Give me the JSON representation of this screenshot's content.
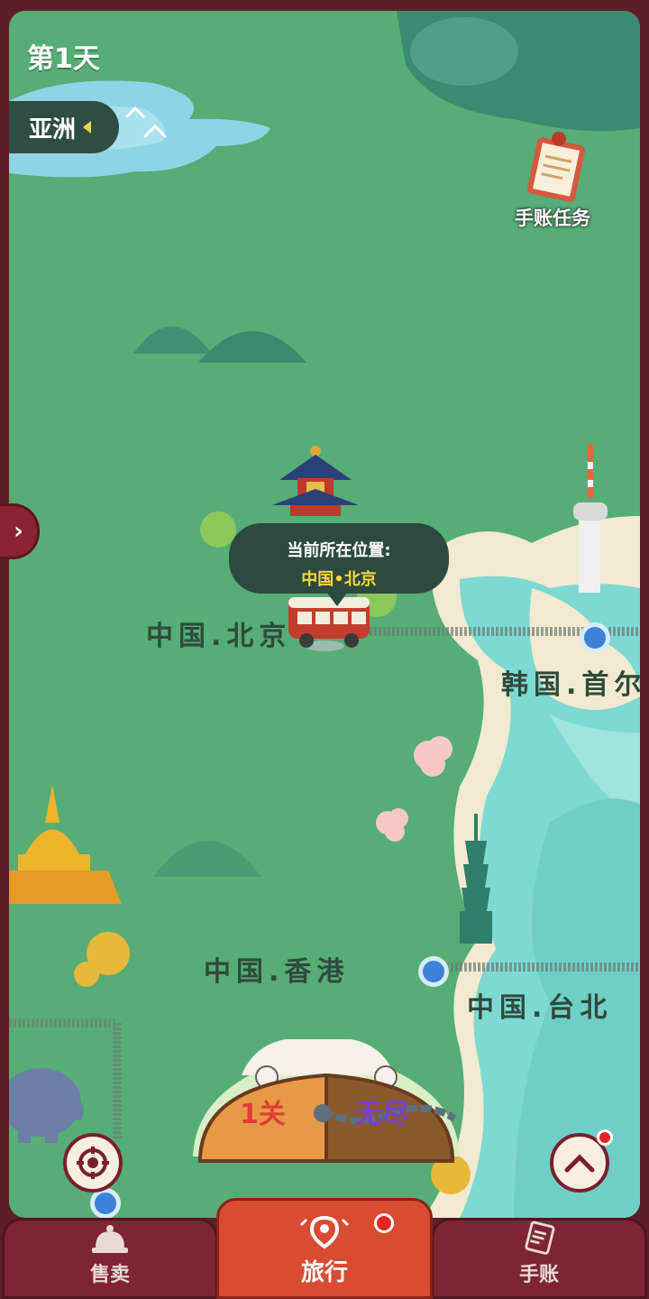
{
  "hud": {
    "day_label": "第1天",
    "region_label": "亚洲",
    "journal_task_label": "手账任务",
    "side_toggle_glyph": "›"
  },
  "location_bubble": {
    "title": "当前所在位置:",
    "place": "中国•北京"
  },
  "map": {
    "cities": [
      {
        "name": "中国.北京",
        "current": true
      },
      {
        "name": "韩国.首尔",
        "current": false
      },
      {
        "name": "中国.香港",
        "current": false
      },
      {
        "name": "中国.台北",
        "current": false
      }
    ]
  },
  "mode_panel": {
    "level_label": "1关",
    "endless_label": "无尽",
    "endless_locked": true
  },
  "bottom_nav": {
    "tabs": [
      {
        "label": "售卖",
        "icon": "bell-icon",
        "active": false
      },
      {
        "label": "旅行",
        "icon": "map-pin-icon",
        "active": true,
        "has_badge": true
      },
      {
        "label": "手账",
        "icon": "notebook-icon",
        "active": false
      }
    ]
  },
  "colors": {
    "land": "#56ad76",
    "sea": "#7ed9d2",
    "frame": "#5c1f2a",
    "accent_red": "#d94b32",
    "badge": "#e52424"
  }
}
